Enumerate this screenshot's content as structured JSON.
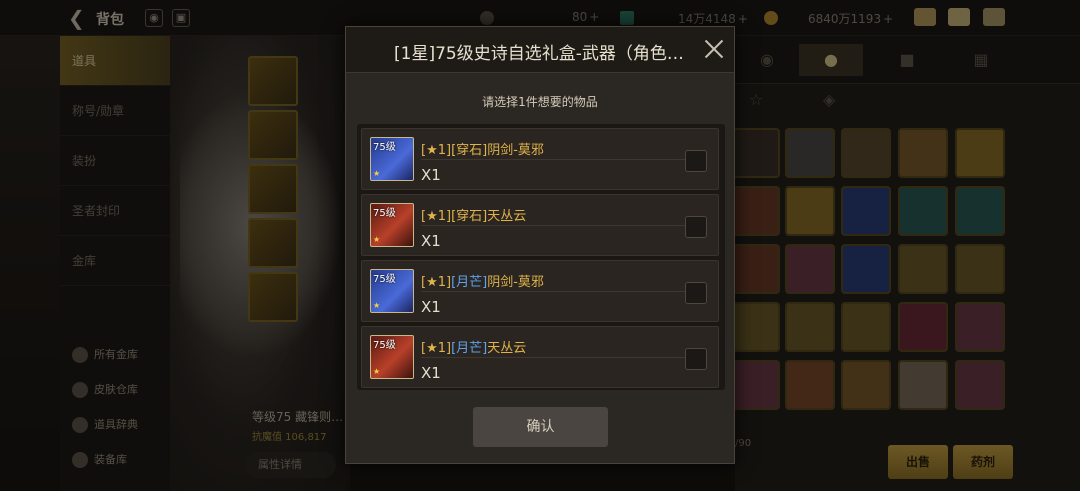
{
  "topbar": {
    "title": "背包",
    "currencies": [
      {
        "value": "80",
        "plus": "+"
      },
      {
        "value": "14万4148",
        "plus": "+"
      },
      {
        "value": "6840万1193",
        "plus": "+"
      }
    ]
  },
  "sidebar": {
    "items": [
      {
        "label": "道具"
      },
      {
        "label": "称号/勋章"
      },
      {
        "label": "装扮"
      },
      {
        "label": "圣者封印"
      },
      {
        "label": "金库"
      }
    ],
    "sub_items": [
      {
        "label": "所有金库"
      },
      {
        "label": "皮肤仓库"
      },
      {
        "label": "道具辞典"
      },
      {
        "label": "装备库"
      }
    ]
  },
  "character": {
    "level_text": "等级75 藏锋则…",
    "value_text": "抗魔值 106,817",
    "attr_button": "属性详情"
  },
  "right": {
    "count_text": "/90",
    "buttons": [
      "出售",
      "药剂"
    ]
  },
  "modal": {
    "title": "[1星]75级史诗自选礼盒-武器（角色…",
    "subtitle": "请选择1件想要的物品",
    "confirm_label": "确认",
    "options": [
      {
        "thumb_level": "75级",
        "star_tag": "[★1]",
        "type_tag": "[穿石]",
        "name": "阴剑-莫邪",
        "qty": "X1",
        "type_color": "gold",
        "thumb_color": "blue"
      },
      {
        "thumb_level": "75级",
        "star_tag": "[★1]",
        "type_tag": "[穿石]",
        "name": "天丛云",
        "qty": "X1",
        "type_color": "gold",
        "thumb_color": "red"
      },
      {
        "thumb_level": "75级",
        "star_tag": "[★1]",
        "type_tag": "[月芒]",
        "name": "阴剑-莫邪",
        "qty": "X1",
        "type_color": "blue",
        "thumb_color": "blue"
      },
      {
        "thumb_level": "75级",
        "star_tag": "[★1]",
        "type_tag": "[月芒]",
        "name": "天丛云",
        "qty": "X1",
        "type_color": "blue",
        "thumb_color": "red"
      }
    ]
  },
  "colors": {
    "accent_gold": "#e0b44a",
    "accent_blue": "#5fa3e8",
    "confirm_bg": "#4a4540"
  }
}
